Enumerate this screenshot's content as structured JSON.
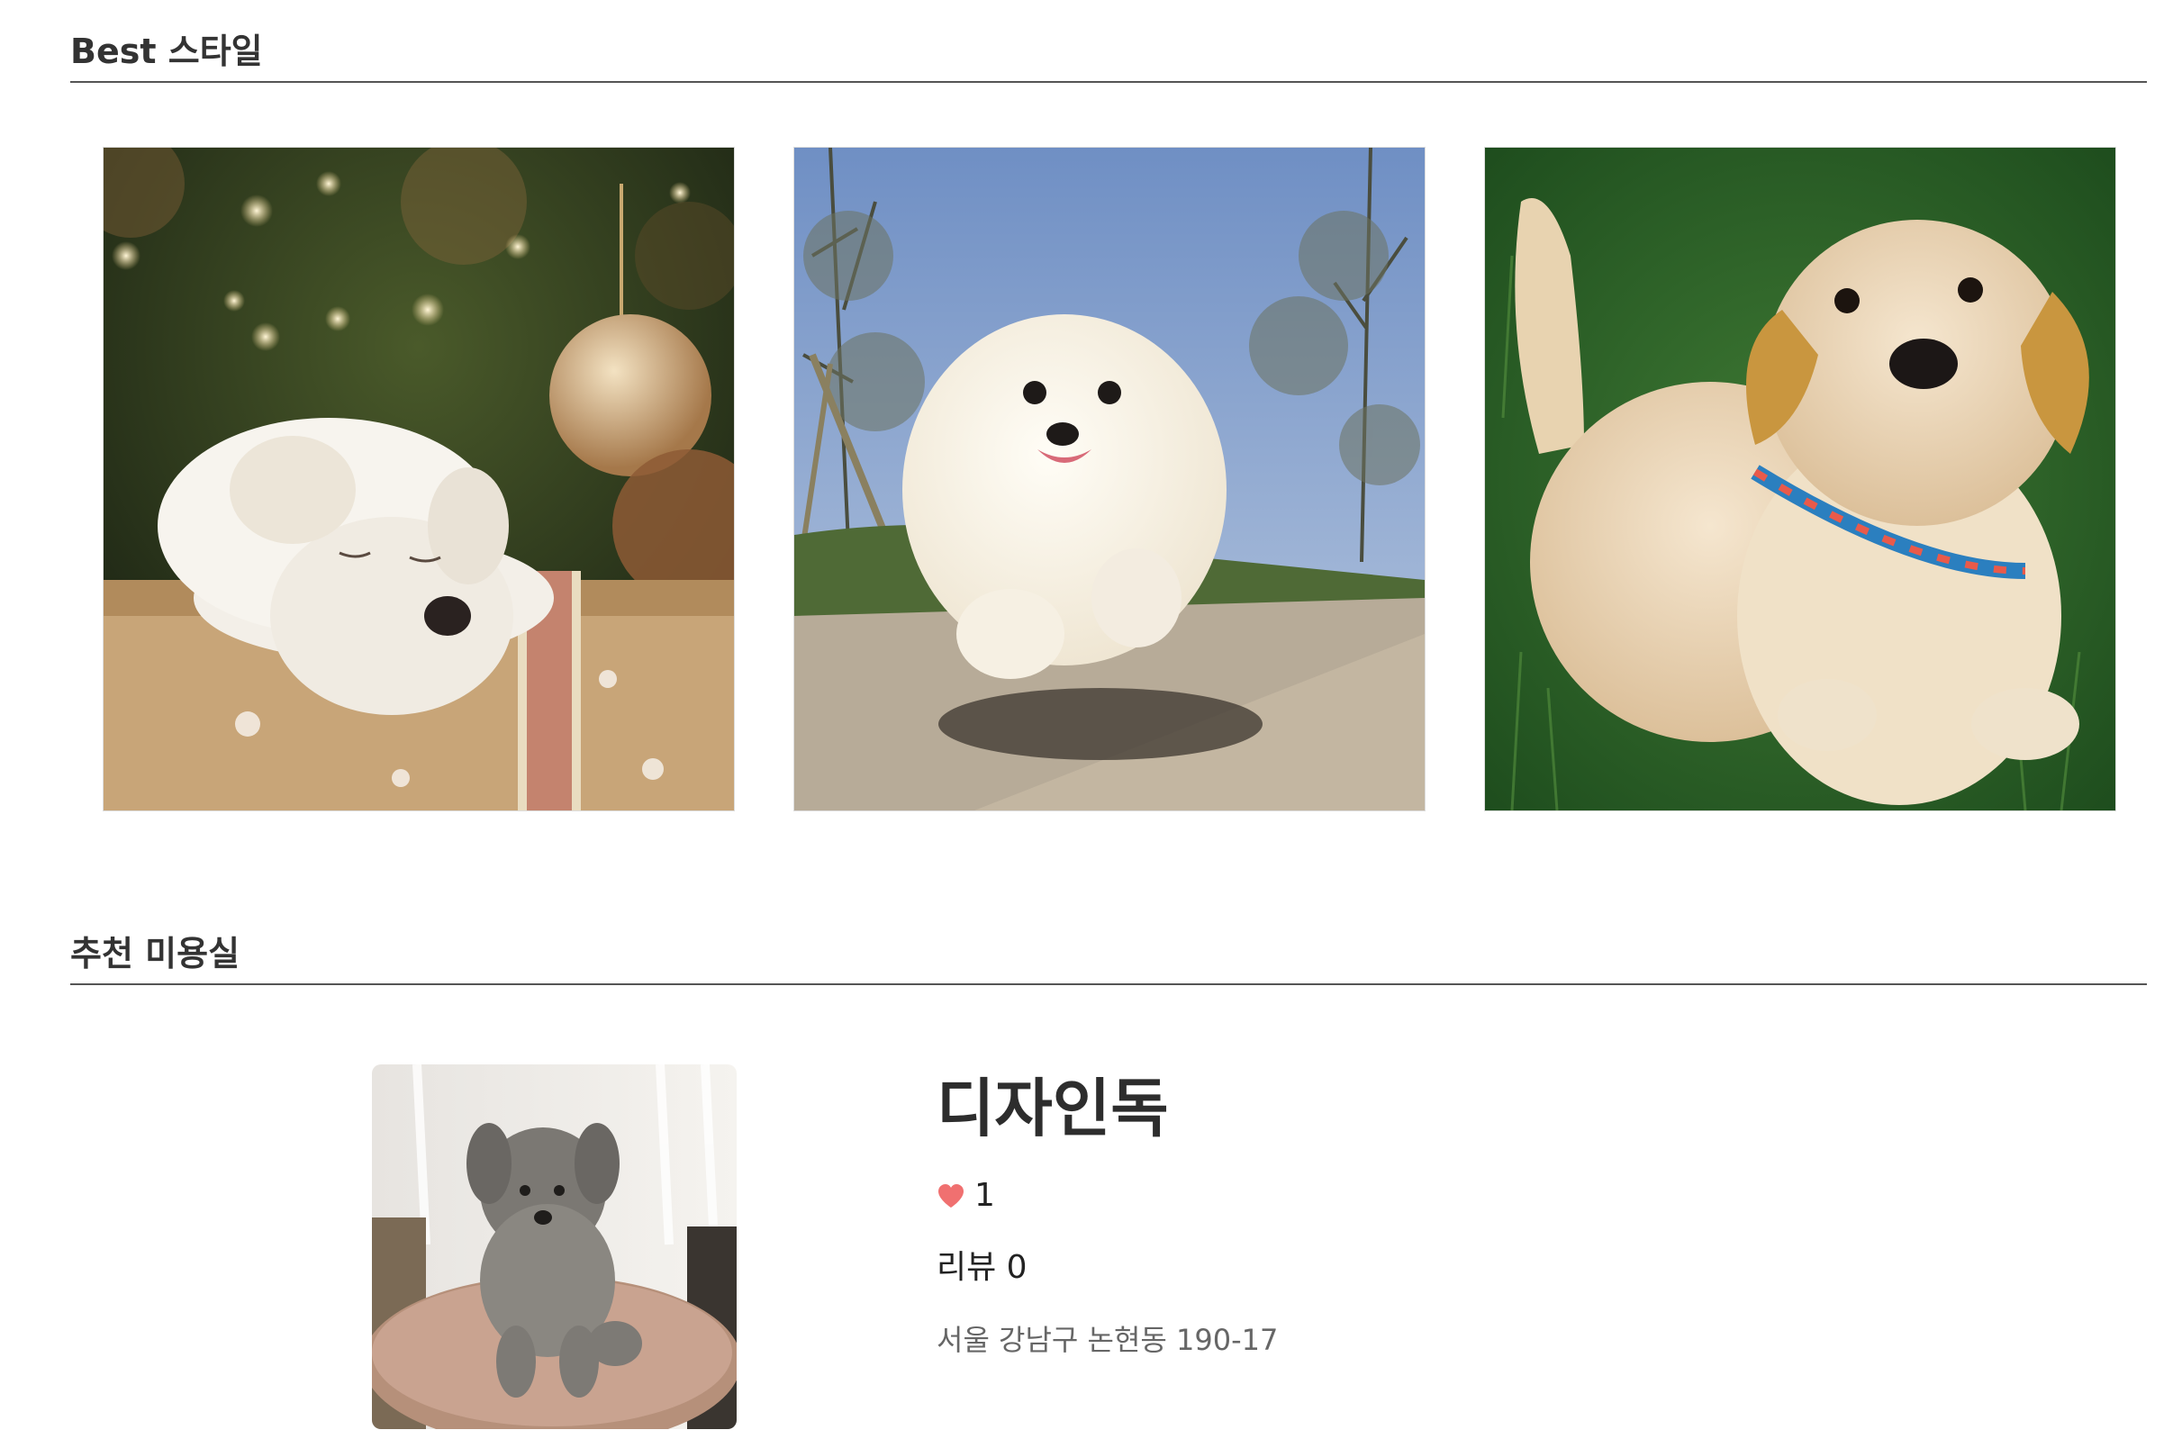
{
  "best_section": {
    "title": "Best 스타일",
    "photos": [
      {
        "subject": "white puppy sleeping on a gift box by a Christmas tree"
      },
      {
        "subject": "fluffy white pomeranian jumping outdoors"
      },
      {
        "subject": "golden retriever puppy sitting on grass with a colorful collar"
      }
    ]
  },
  "salon_section": {
    "title": "추천 미용실",
    "salon": {
      "name": "디자인독",
      "likes": "1",
      "reviews": "리뷰 0",
      "address": "서울 강남구 논현동 190-17",
      "photo": "gray poodle sitting on a grooming table"
    }
  },
  "colors": {
    "heart": "#f07070",
    "divider": "#555555",
    "text": "#333333",
    "address": "#666666"
  }
}
